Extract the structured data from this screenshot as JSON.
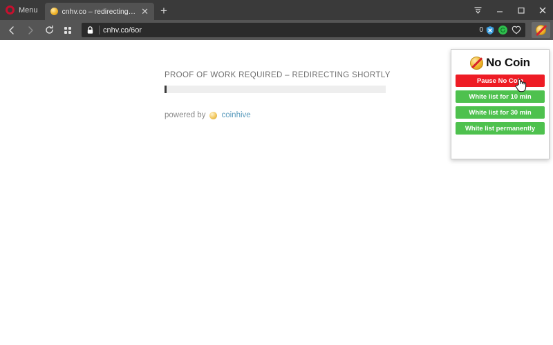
{
  "window": {
    "menu_label": "Menu",
    "controls": {
      "tab_menu_icon": "tab-menu-icon",
      "minimize_label": "minimize-icon",
      "maximize_label": "maximize-icon",
      "close_label": "close-icon"
    }
  },
  "tabs": [
    {
      "title": "cnhv.co – redirecting…",
      "favicon": "coin-favicon",
      "close_label": "✕",
      "active": true
    }
  ],
  "new_tab_label": "+",
  "navigation": {
    "back_icon": "back-arrow-icon",
    "forward_icon": "forward-arrow-icon",
    "reload_icon": "reload-icon",
    "speeddial_icon": "speed-dial-icon"
  },
  "address_bar": {
    "security_icon": "lock-icon",
    "url": "cnhv.co/6or",
    "blocked_count": "0",
    "shield_icon": "ad-blocker-shield-icon",
    "vpn_icon": "vpn-badge-icon",
    "heart_icon": "heart-icon",
    "extension_icon": "no-coin-extension-icon"
  },
  "page": {
    "heading": "PROOF OF WORK REQUIRED – REDIRECTING SHORTLY",
    "progress_percent": 1,
    "powered_by_label": "powered by",
    "powered_by_link": "coinhive",
    "coin_icon": "coinhive-coin-icon"
  },
  "popup": {
    "icon": "no-coin-logo-icon",
    "title": "No Coin",
    "buttons": [
      {
        "label": "Pause No Coin",
        "style": "danger"
      },
      {
        "label": "White list for 10 min",
        "style": "ok"
      },
      {
        "label": "White list for 30 min",
        "style": "ok"
      },
      {
        "label": "White list permanently",
        "style": "ok"
      }
    ]
  },
  "colors": {
    "chrome_dark": "#3a3a3a",
    "chrome_navbar": "#555555",
    "address_field": "#2b2b2b",
    "danger": "#ee1c25",
    "ok": "#4ec14e",
    "link": "#5a9bbd",
    "coin_gold": "#f0b429"
  }
}
